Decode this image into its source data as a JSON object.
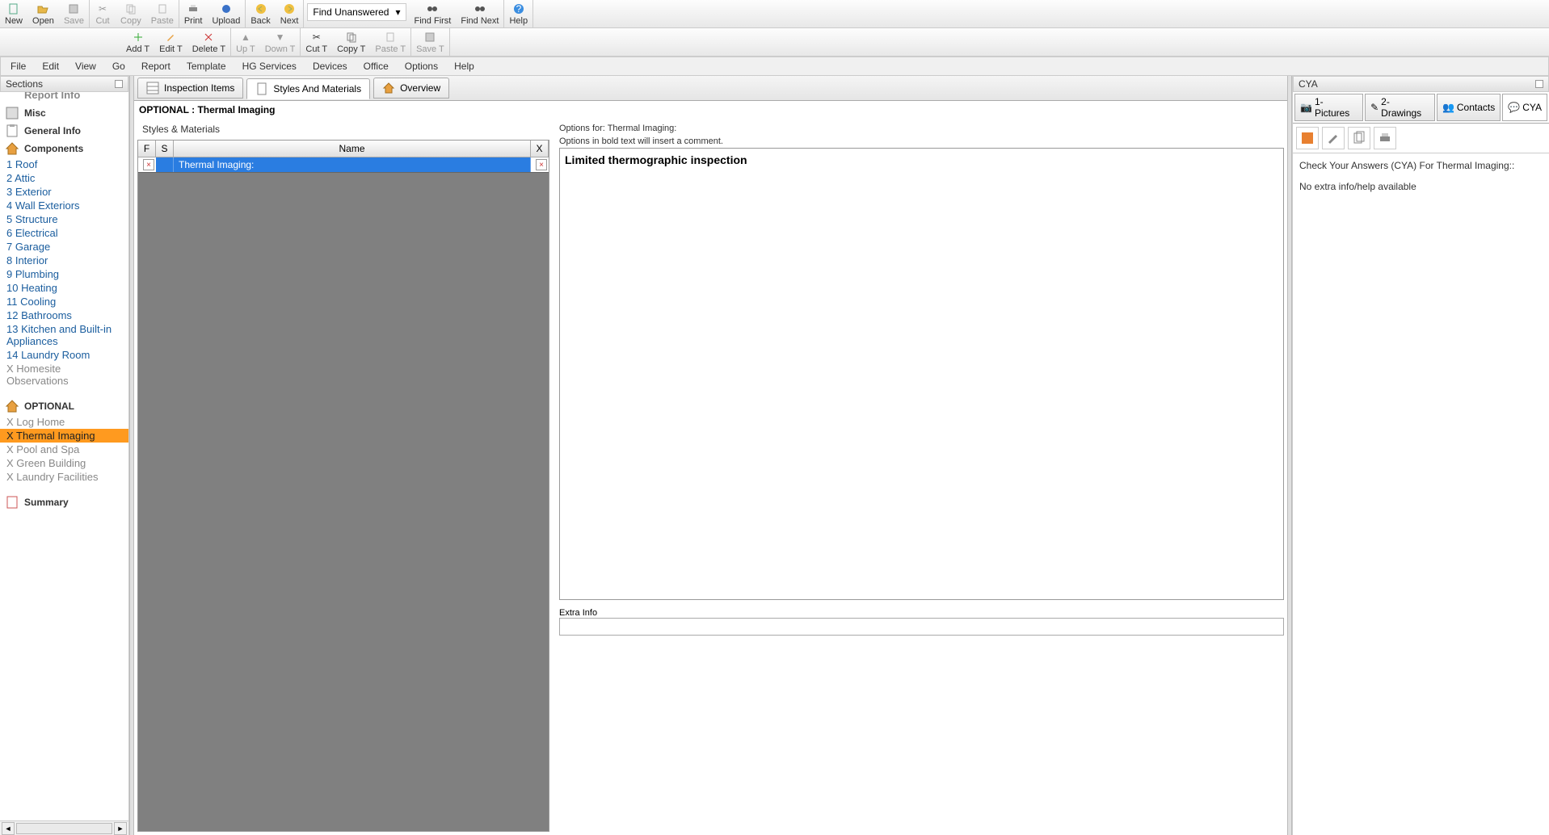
{
  "toolbar1": {
    "new": "New",
    "open": "Open",
    "save": "Save",
    "cut": "Cut",
    "copy": "Copy",
    "paste": "Paste",
    "print": "Print",
    "upload": "Upload",
    "back": "Back",
    "next": "Next",
    "find_combo": "Find Unanswered",
    "find_first": "Find First",
    "find_next": "Find Next",
    "help": "Help"
  },
  "toolbar2": {
    "add_t": "Add T",
    "edit_t": "Edit T",
    "delete_t": "Delete T",
    "up_t": "Up T",
    "down_t": "Down T",
    "cut_t": "Cut T",
    "copy_t": "Copy T",
    "paste_t": "Paste T",
    "save_t": "Save T"
  },
  "menubar": [
    "File",
    "Edit",
    "View",
    "Go",
    "Report",
    "Template",
    "HG Services",
    "Devices",
    "Office",
    "Options",
    "Help"
  ],
  "sections": {
    "header": "Sections",
    "report_info": "Report Info",
    "misc": "Misc",
    "general_info": "General Info",
    "components": "Components",
    "comp_items": [
      "1 Roof",
      "2 Attic",
      "3 Exterior",
      "4 Wall Exteriors",
      "5 Structure",
      "6 Electrical",
      "7 Garage",
      "8 Interior",
      "9 Plumbing",
      "10 Heating",
      "11 Cooling",
      "12 Bathrooms",
      "13 Kitchen and Built-in Appliances",
      "14 Laundry Room",
      "X Homesite Observations"
    ],
    "optional_label": "OPTIONAL",
    "optional_items": [
      "X Log Home",
      "X Thermal Imaging",
      "X Pool and Spa",
      "X Green Building",
      "X Laundry Facilities"
    ],
    "summary": "Summary"
  },
  "tabs": {
    "inspection_items": "Inspection Items",
    "styles_materials": "Styles And Materials",
    "overview": "Overview"
  },
  "content": {
    "title": "OPTIONAL : Thermal Imaging",
    "subtitle": "Styles & Materials",
    "cols": {
      "f": "F",
      "s": "S",
      "name": "Name",
      "x": "X"
    },
    "row_name": "Thermal Imaging:",
    "opt_line1": "Options for: Thermal Imaging:",
    "opt_line2": "Options in bold text will insert a comment.",
    "opt_item": "Limited thermographic inspection",
    "extra_info": "Extra Info"
  },
  "cya": {
    "header": "CYA",
    "tabs": {
      "pictures": "1-Pictures",
      "drawings": "2-Drawings",
      "contacts": "Contacts",
      "cya": "CYA"
    },
    "body1": "Check Your Answers (CYA) For Thermal Imaging::",
    "body2": "No extra info/help available"
  }
}
